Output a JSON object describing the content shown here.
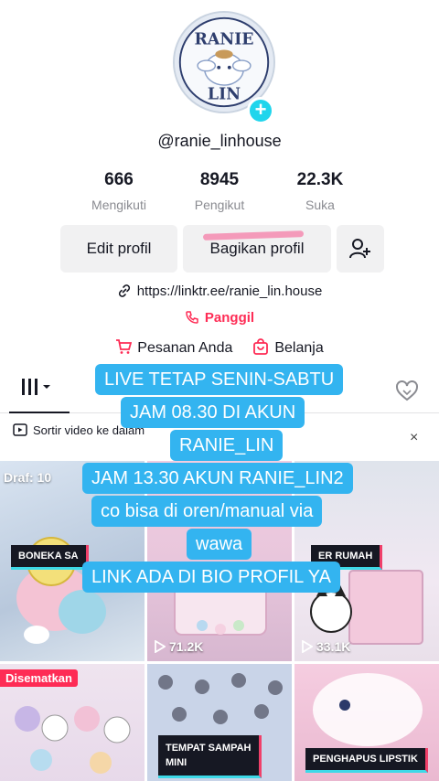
{
  "profile": {
    "avatar_text": "RANIE LIN",
    "username": "@ranie_linhouse",
    "stats": [
      {
        "value": "666",
        "label": "Mengikuti"
      },
      {
        "value": "8945",
        "label": "Pengikut"
      },
      {
        "value": "22.3K",
        "label": "Suka"
      }
    ],
    "edit_button": "Edit profil",
    "share_button": "Bagikan profil",
    "link": "https://linktr.ee/ranie_lin.house",
    "call": "Panggil",
    "orders": "Pesanan Anda",
    "shop": "Belanja"
  },
  "feed": {
    "sort_text": "Sortir video ke dalam",
    "close": "×",
    "videos": [
      {
        "badge": "Draf: 10",
        "label": "BONEKA SA",
        "views": ""
      },
      {
        "badge": "",
        "label": "",
        "views": "71.2K"
      },
      {
        "badge": "",
        "label": "ER RUMAH",
        "views": "33.1K"
      },
      {
        "badge": "Disematkan",
        "label": "",
        "views": ""
      },
      {
        "badge": "",
        "label": "TEMPAT SAMPAH\nMINI",
        "views": ""
      },
      {
        "badge": "",
        "label": "PENGHAPUS LIPSTIK",
        "views": ""
      }
    ]
  },
  "overlay_text": [
    "LIVE TETAP SENIN-SABTU",
    "JAM 08.30 DI AKUN",
    "RANIE_LIN",
    "JAM 13.30 AKUN RANIE_LIN2",
    "co bisa di oren/manual via",
    "wawa",
    "LINK ADA DI BIO PROFIL YA"
  ],
  "colors": {
    "accent": "#fe2c55",
    "overlay": "#33b4f0",
    "plus": "#20d5ec"
  }
}
